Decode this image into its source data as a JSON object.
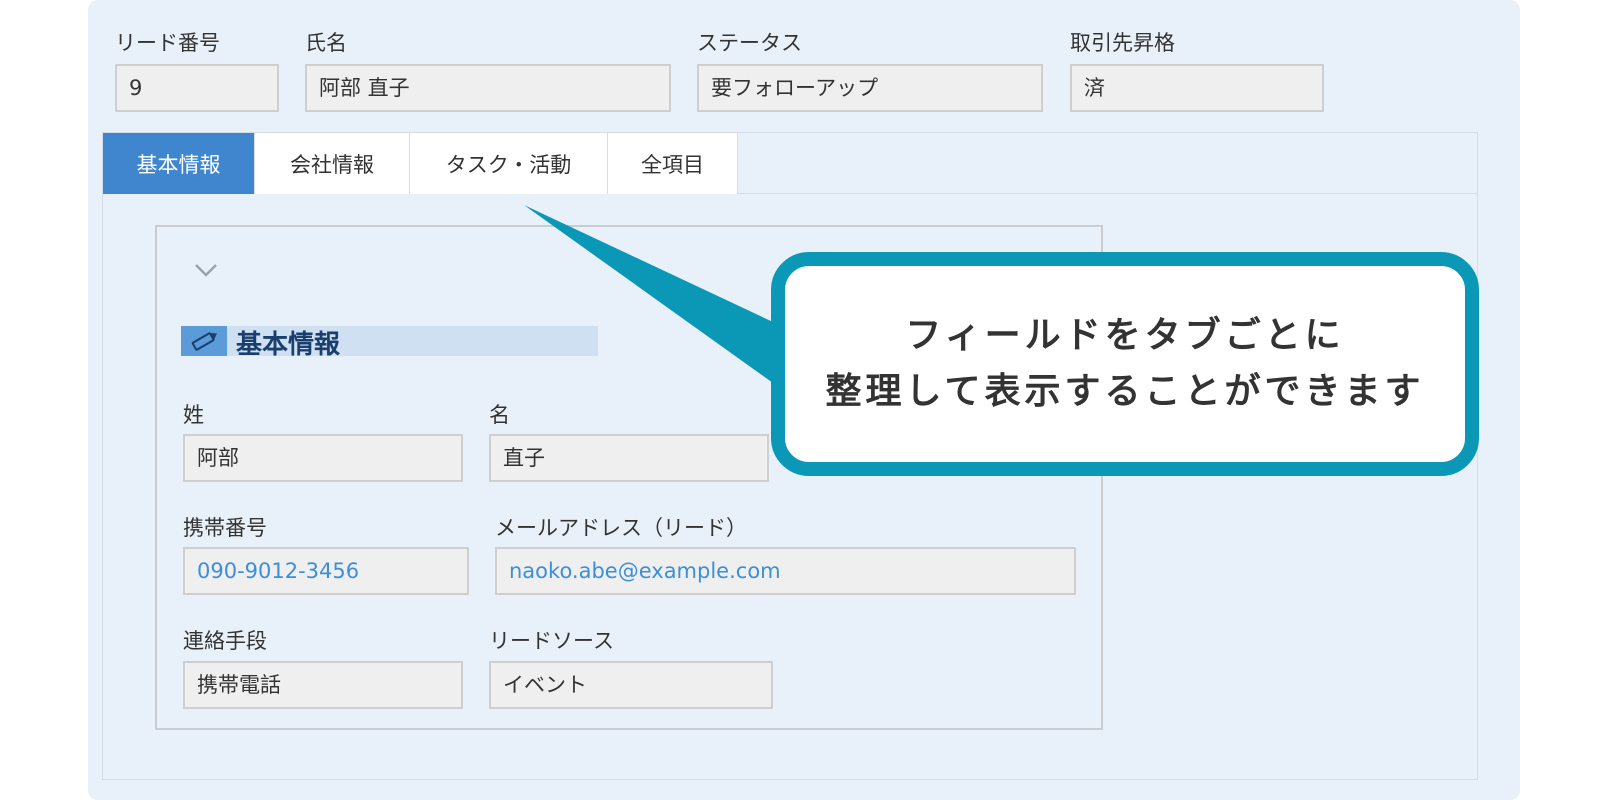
{
  "header": {
    "lead_number": {
      "label": "リード番号",
      "value": "9"
    },
    "full_name": {
      "label": "氏名",
      "value": "阿部 直子"
    },
    "status": {
      "label": "ステータス",
      "value": "要フォローアップ"
    },
    "promotion": {
      "label": "取引先昇格",
      "value": "済"
    }
  },
  "tabs": [
    {
      "label": "基本情報",
      "active": true
    },
    {
      "label": "会社情報",
      "active": false
    },
    {
      "label": "タスク・活動",
      "active": false
    },
    {
      "label": "全項目",
      "active": false
    }
  ],
  "section": {
    "title": "基本情報",
    "collapse_icon": "chevron-down-icon",
    "title_icon": "pencil-icon",
    "fields": {
      "last_name": {
        "label": "姓",
        "value": "阿部"
      },
      "first_name": {
        "label": "名",
        "value": "直子"
      },
      "mobile": {
        "label": "携帯番号",
        "value": "090-9012-3456"
      },
      "email": {
        "label": "メールアドレス（リード）",
        "value": "naoko.abe@example.com"
      },
      "contact_method": {
        "label": "連絡手段",
        "value": "携帯電話"
      },
      "lead_source": {
        "label": "リードソース",
        "value": "イベント"
      }
    }
  },
  "callout": {
    "line1": "フィールドをタブごとに",
    "line2": "整理して表示することができます"
  },
  "colors": {
    "panel_bg": "#e8f1fa",
    "active_tab": "#3f86cf",
    "link": "#3b8fd9",
    "callout_border": "#0a98b6",
    "section_title": "#1a3f6e"
  }
}
